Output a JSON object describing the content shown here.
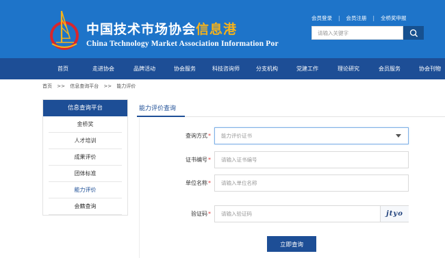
{
  "header": {
    "title_cn_main": "中国技术市场协会",
    "title_cn_accent": "信息港",
    "title_en": "China Technology Market Association Information Por",
    "top_links": [
      "会员登录",
      "会员注册",
      "全桥奖申报"
    ],
    "search_placeholder": "请输入关键字",
    "search_icon": "search-icon",
    "colors": {
      "header_bg": "#1e74c9",
      "nav_bg": "#1d4e96",
      "accent": "#f5b21b"
    }
  },
  "nav": {
    "items": [
      "首页",
      "走进协会",
      "品牌活动",
      "协会服务",
      "科技咨询师",
      "分支机构",
      "党建工作",
      "理论研究",
      "会员服务",
      "协会刊物"
    ]
  },
  "breadcrumb": [
    "首页",
    ">>",
    "信息查询平台",
    ">>",
    "能力评价"
  ],
  "sidebar": {
    "title": "信息查询平台",
    "items": [
      "金桥奖",
      "人才培训",
      "成果评价",
      "团体标准",
      "能力评价",
      "会籍查询"
    ],
    "active_index": 4
  },
  "main": {
    "tab": "能力评价查询",
    "form": {
      "query_type": {
        "label": "查询方式",
        "required": "*",
        "value": "能力评价证书"
      },
      "cert_no": {
        "label": "证书编号",
        "required": "*",
        "placeholder": "请输入证书编号"
      },
      "org_name": {
        "label": "单位名称",
        "required": "*",
        "placeholder": "请输入单位名称"
      },
      "captcha": {
        "label": "验证码",
        "required": "*",
        "placeholder": "请输入验证码",
        "image_text": "jtyo"
      }
    },
    "submit_label": "立即查询"
  }
}
